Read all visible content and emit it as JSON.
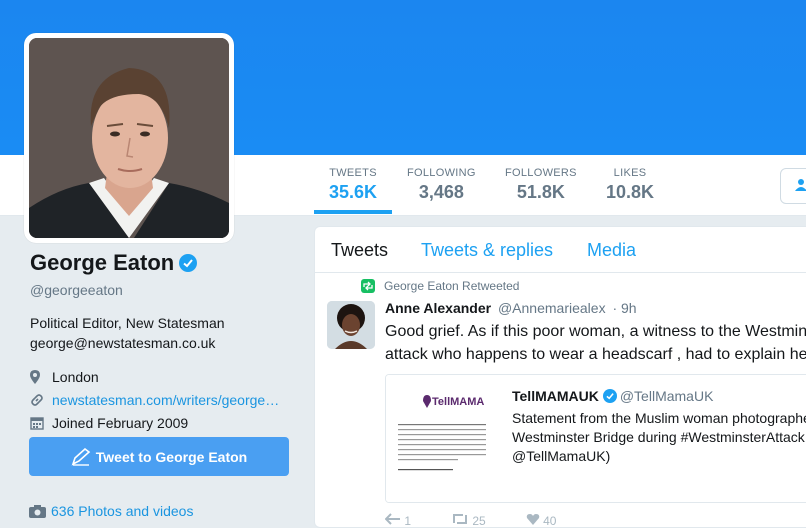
{
  "colors": {
    "brand": "#1da1f2",
    "banner": "#1a8cf4",
    "link": "#1b95e0",
    "button": "#4a9ff2",
    "muted": "#657786"
  },
  "profile": {
    "name": "George Eaton",
    "handle": "@georgeeaton",
    "bio_line1": "Political Editor, New Statesman",
    "bio_line2": "george@newstatesman.co.uk",
    "location": "London",
    "website": "newstatesman.com/writers/george…",
    "joined": "Joined February 2009",
    "tweet_to_label": "Tweet to George Eaton",
    "photos_label": "636 Photos and videos"
  },
  "stats": [
    {
      "label": "TWEETS",
      "value": "35.6K",
      "active": true
    },
    {
      "label": "FOLLOWING",
      "value": "3,468"
    },
    {
      "label": "FOLLOWERS",
      "value": "51.8K"
    },
    {
      "label": "LIKES",
      "value": "10.8K"
    }
  ],
  "tabs": {
    "tweets": "Tweets",
    "replies": "Tweets & replies",
    "media": "Media"
  },
  "tweet": {
    "retweet_note": "George Eaton Retweeted",
    "author": "Anne Alexander",
    "handle": "@Annemariealex",
    "time": "· 9h",
    "line1": "Good grief. As if this poor woman, a witness to the Westminster",
    "line2": "attack who happens to wear a headscarf ,  had to explain herself",
    "quote": {
      "author": "TellMAMAUK",
      "handle": "@TellMamaUK",
      "line1": "Statement from the Muslim woman photographed on",
      "line2": "Westminster Bridge during #WestminsterAttack (via",
      "line3": "@TellMamaUK)",
      "thumb_logo": "TellMAMA"
    },
    "actions": {
      "reply": "1",
      "retweet": "25",
      "like": "40"
    }
  },
  "icons": [
    "verified-badge-icon",
    "location-pin-icon",
    "link-icon",
    "calendar-icon",
    "compose-icon",
    "camera-icon",
    "retweet-icon",
    "follow-icon",
    "reply-icon",
    "like-icon"
  ]
}
